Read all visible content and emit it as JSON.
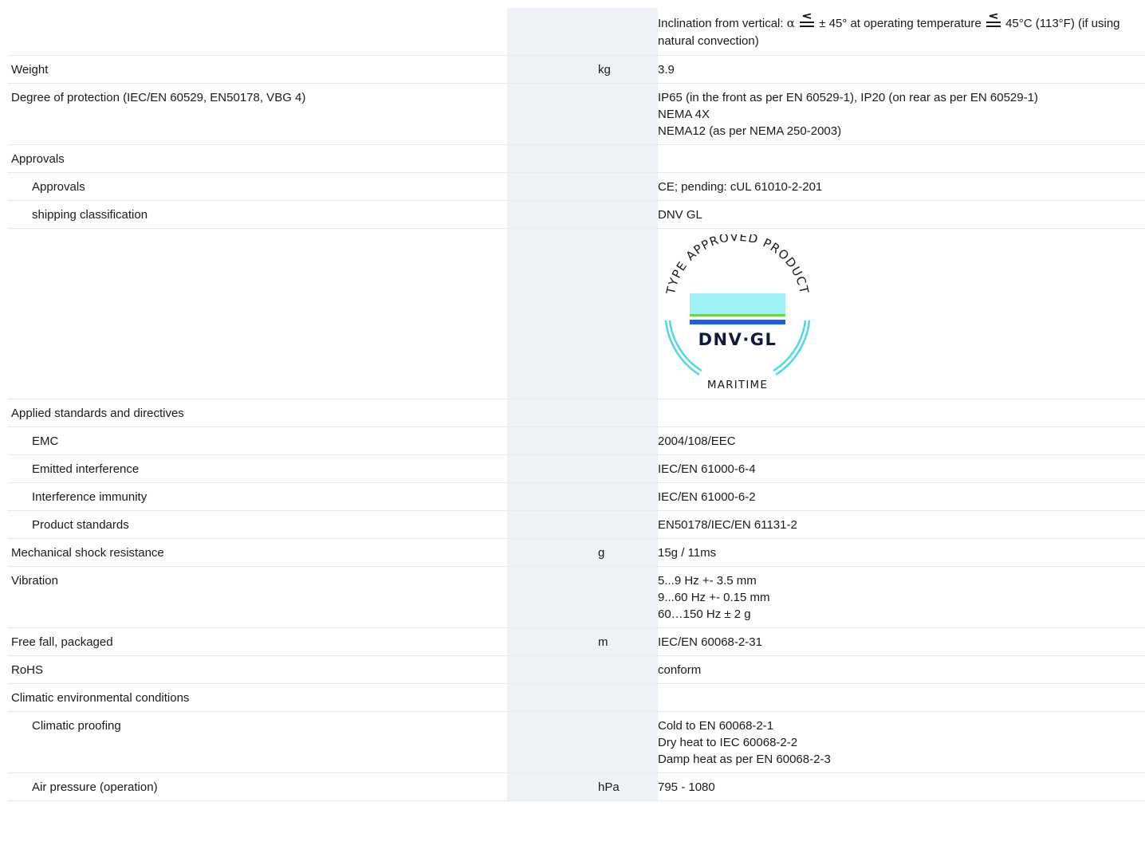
{
  "rows": [
    {
      "id": "inclination",
      "name": "",
      "unit": "",
      "sub": false,
      "values": []
    },
    {
      "id": "weight",
      "name": "Weight",
      "unit": "kg",
      "sub": false,
      "values": [
        "3.9"
      ]
    },
    {
      "id": "protection",
      "name": "Degree of protection (IEC/EN 60529, EN50178, VBG 4)",
      "unit": "",
      "sub": false,
      "values": [
        "IP65 (in the front as per EN 60529-1), IP20 (on rear as per EN 60529-1)",
        "NEMA 4X",
        "NEMA12 (as per NEMA 250-2003)"
      ]
    },
    {
      "id": "approvals",
      "name": "Approvals",
      "unit": "",
      "sub": false,
      "values": []
    },
    {
      "id": "approvals-sub",
      "name": "Approvals",
      "unit": "",
      "sub": true,
      "values": [
        "CE; pending: cUL 61010-2-201"
      ]
    },
    {
      "id": "shipping",
      "name": "shipping classification",
      "unit": "",
      "sub": true,
      "values": [
        "DNV GL"
      ]
    },
    {
      "id": "logo-row",
      "name": "",
      "unit": "",
      "sub": true,
      "values": []
    },
    {
      "id": "standards",
      "name": "Applied standards and directives",
      "unit": "",
      "sub": false,
      "values": []
    },
    {
      "id": "emc",
      "name": "EMC",
      "unit": "",
      "sub": true,
      "values": [
        "2004/108/EEC"
      ]
    },
    {
      "id": "emitted",
      "name": "Emitted interference",
      "unit": "",
      "sub": true,
      "values": [
        "IEC/EN 61000-6-4"
      ]
    },
    {
      "id": "immunity",
      "name": "Interference immunity",
      "unit": "",
      "sub": true,
      "values": [
        "IEC/EN 61000-6-2"
      ]
    },
    {
      "id": "product-std",
      "name": "Product standards",
      "unit": "",
      "sub": true,
      "values": [
        "EN50178/IEC/EN 61131-2"
      ]
    },
    {
      "id": "shock",
      "name": "Mechanical shock resistance",
      "unit": "g",
      "sub": false,
      "values": [
        "15g / 11ms"
      ]
    },
    {
      "id": "vibration",
      "name": "Vibration",
      "unit": "",
      "sub": false,
      "values": [
        "5...9 Hz +- 3.5 mm",
        "9...60 Hz +- 0.15 mm",
        "60…150 Hz ± 2 g"
      ]
    },
    {
      "id": "free-fall",
      "name": "Free fall, packaged",
      "unit": "m",
      "sub": false,
      "values": [
        "IEC/EN 60068-2-31"
      ]
    },
    {
      "id": "rohs",
      "name": "RoHS",
      "unit": "",
      "sub": false,
      "values": [
        "conform"
      ]
    },
    {
      "id": "climatic",
      "name": "Climatic environmental conditions",
      "unit": "",
      "sub": false,
      "values": []
    },
    {
      "id": "climatic-proofing",
      "name": "Climatic proofing",
      "unit": "",
      "sub": true,
      "values": [
        "Cold to EN 60068-2-1",
        "Dry heat to IEC 60068-2-2",
        "Damp heat as per EN 60068-2-3"
      ]
    },
    {
      "id": "air-pressure",
      "name": "Air pressure (operation)",
      "unit": "hPa",
      "sub": true,
      "values": [
        "795 - 1080"
      ]
    }
  ],
  "inclination": {
    "part1": "Inclination from vertical: ",
    "alpha": "α",
    "part2": " ± 45° at operating temperature ",
    "part3": " 45°C (113°F) (if using natural convection)"
  },
  "logo": {
    "arc_text": "TYPE APPROVED PRODUCT",
    "brand": "DNV·GL",
    "sector": "MARITIME",
    "colors": {
      "light_cyan": "#9ff3f8",
      "green": "#6fd34a",
      "blue": "#1f5fe8",
      "navy": "#0f1a3c",
      "ring": "#4fd8e6"
    }
  },
  "colors": {
    "shade": "#eef1f5",
    "rule": "#e6eaee",
    "text": "#1a1a1a"
  }
}
